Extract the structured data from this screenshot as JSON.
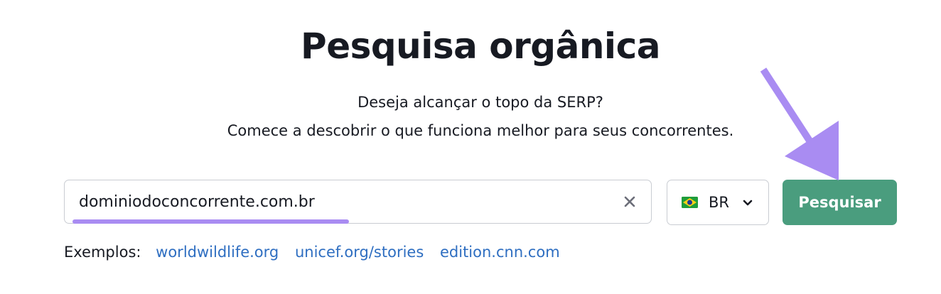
{
  "header": {
    "title": "Pesquisa orgânica",
    "subtitle_line1": "Deseja alcançar o topo da SERP?",
    "subtitle_line2": "Comece a descobrir o que funciona melhor para seus concorrentes."
  },
  "search": {
    "value": "dominiodoconcorrente.com.br",
    "clear_icon": "close-icon"
  },
  "country": {
    "flag_icon": "brazil-flag-icon",
    "code": "BR",
    "dropdown_icon": "chevron-down-icon"
  },
  "actions": {
    "search_label": "Pesquisar"
  },
  "examples": {
    "label": "Exemplos:",
    "links": [
      "worldwildlife.org",
      "unicef.org/stories",
      "edition.cnn.com"
    ]
  },
  "colors": {
    "accent_button": "#4a9d7e",
    "link": "#2e6ec1",
    "annotation": "#a98cf2",
    "text": "#171a22"
  }
}
